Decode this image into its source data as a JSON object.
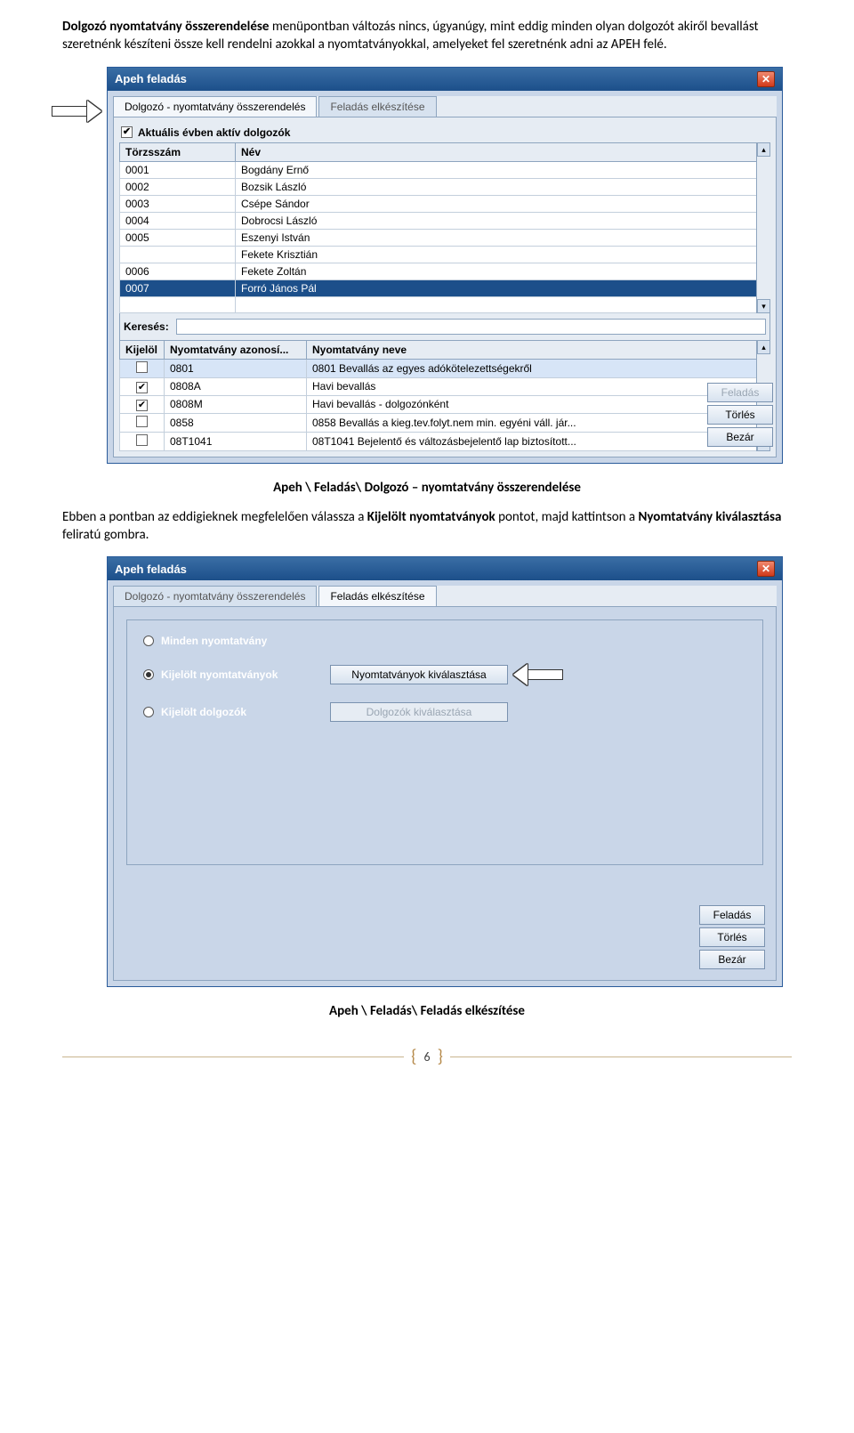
{
  "doc": {
    "para1_a": "Dolgozó nyomtatvány összerendelése",
    "para1_b": " menüpontban változás nincs, úgyanúgy, mint eddig minden olyan dolgozót akiről bevallást szeretnénk készíteni össze kell rendelni azokkal a nyomtatványokkal, amelyeket  fel szeretnénk adni az APEH felé.",
    "caption1": "Apeh \\ Feladás\\ Dolgozó – nyomtatvány összerendelése",
    "para2_a": "Ebben a pontban az eddigieknek megfelelően válassza a ",
    "para2_b": "Kijelölt nyomtatványok",
    "para2_c": " pontot, majd kattintson a ",
    "para2_d": "Nyomtatvány kiválasztása",
    "para2_e": " feliratú gombra.",
    "caption2": "Apeh \\ Feladás\\ Feladás elkészítése",
    "page_number": "6"
  },
  "win1": {
    "title": "Apeh  feladás",
    "tab1": "Dolgozó - nyomtatvány összerendelés",
    "tab2": "Feladás elkészítése",
    "chk_active": "Aktuális évben aktív dolgozók",
    "th_torzs": "Törzsszám",
    "th_nev": "Név",
    "search_label": "Keresés:",
    "employees": [
      {
        "id": "0001",
        "name": "Bogdány Ernő"
      },
      {
        "id": "0002",
        "name": "Bozsik László"
      },
      {
        "id": "0003",
        "name": "Csépe Sándor"
      },
      {
        "id": "0004",
        "name": "Dobrocsi László"
      },
      {
        "id": "0005",
        "name": "Eszenyi István"
      },
      {
        "id": "",
        "name": "Fekete Krisztián"
      },
      {
        "id": "0006",
        "name": "Fekete Zoltán"
      },
      {
        "id": "0007",
        "name": "Forró János Pál"
      }
    ],
    "th_kijelol": "Kijelöl",
    "th_nyid": "Nyomtatvány azonosí...",
    "th_nynev": "Nyomtatvány neve",
    "forms": [
      {
        "chk": false,
        "id": "0801",
        "name": "0801 Bevallás az egyes adókötelezettségekről"
      },
      {
        "chk": true,
        "id": "0808A",
        "name": "Havi bevallás"
      },
      {
        "chk": true,
        "id": "0808M",
        "name": "Havi bevallás - dolgozónként"
      },
      {
        "chk": false,
        "id": "0858",
        "name": "0858 Bevallás a kieg.tev.folyt.nem min. egyéni váll. jár..."
      },
      {
        "chk": false,
        "id": "08T1041",
        "name": "08T1041 Bejelentő és változásbejelentő lap biztosított..."
      }
    ],
    "btn_feladas": "Feladás",
    "btn_torles": "Törlés",
    "btn_bezar": "Bezár"
  },
  "win2": {
    "title": "Apeh  feladás",
    "tab1": "Dolgozó - nyomtatvány összerendelés",
    "tab2": "Feladás elkészítése",
    "opt1": "Minden nyomtatvány",
    "opt2": "Kijelölt nyomtatványok",
    "opt3": "Kijelölt dolgozók",
    "btn_sel_forms": "Nyomtatványok kiválasztása",
    "btn_sel_emps": "Dolgozók kiválasztása",
    "btn_feladas": "Feladás",
    "btn_torles": "Törlés",
    "btn_bezar": "Bezár"
  }
}
